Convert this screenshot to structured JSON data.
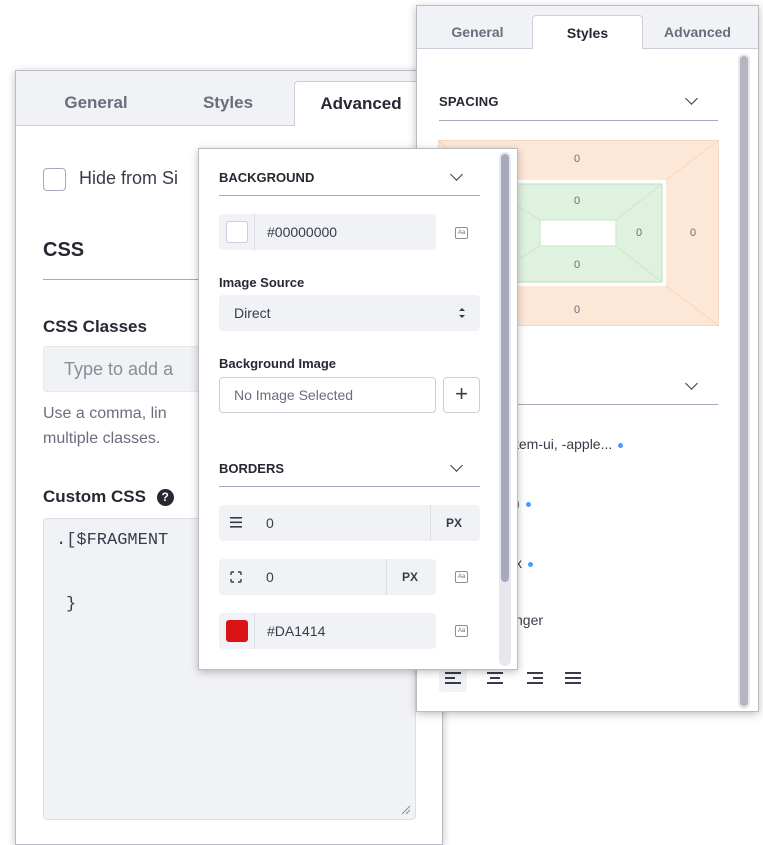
{
  "panel_advanced": {
    "tabs": [
      "General",
      "Styles",
      "Advanced"
    ],
    "active_tab": "Advanced",
    "hide_checkbox_label": "Hide from Si",
    "css_heading": "CSS",
    "css_classes_label": "CSS Classes",
    "css_classes_placeholder": "Type to add a",
    "help_line1": "Use a comma, lin",
    "help_line2": "multiple classes.",
    "custom_css_label": "Custom CSS",
    "help_icon_glyph": "?",
    "code_line1": ".[$FRAGMENT",
    "code_line2": "}"
  },
  "panel_styles": {
    "tabs": [
      "General",
      "Styles",
      "Advanced"
    ],
    "active_tab": "Styles",
    "spacing_title": "SPACING",
    "spacing": {
      "margin_top": "0",
      "padding_top": "0",
      "padding_left": "0",
      "padding_right": "0",
      "margin_right": "0",
      "padding_bottom": "0",
      "margin_bottom": "0"
    },
    "font_family": "tem-ui, -apple...",
    "font_size_partial": ")",
    "line_height_partial": "x",
    "font_weight_partial": "nger",
    "colors": {
      "margin": "#fde8d8",
      "padding": "#dff2e0",
      "dot": "#4b9bff"
    }
  },
  "panel_background": {
    "background_title": "BACKGROUND",
    "bg_color_value": "#00000000",
    "image_source_label": "Image Source",
    "image_source_value": "Direct",
    "background_image_label": "Background Image",
    "background_image_value": "No Image Selected",
    "add_glyph": "+",
    "borders_title": "BORDERS",
    "border_width_value": "0",
    "border_width_unit": "PX",
    "border_radius_value": "0",
    "border_radius_unit": "PX",
    "border_color_value": "#DA1414",
    "border_color_swatch": "#da1414"
  }
}
